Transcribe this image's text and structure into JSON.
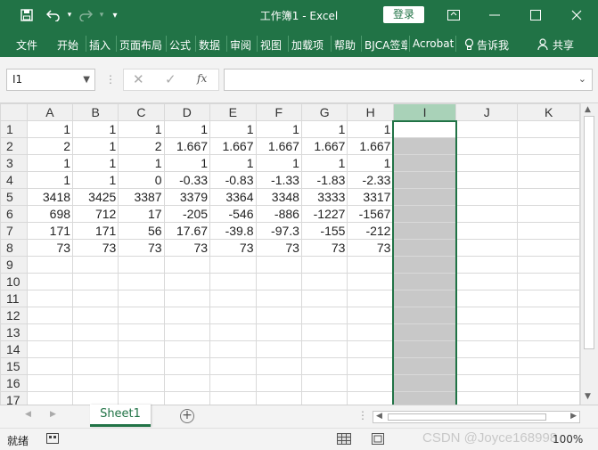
{
  "title": {
    "window_title": "工作簿1  -  Excel",
    "login_label": "登录"
  },
  "ribbon": {
    "tabs": [
      "文件",
      "开始",
      "插入",
      "页面布局",
      "公式",
      "数据",
      "审阅",
      "视图",
      "加载项",
      "帮助",
      "BJCA签章",
      "Acrobat"
    ],
    "tell_me": "告诉我",
    "share": "共享"
  },
  "formula_bar": {
    "name_box": "I1",
    "fx_label": "fx",
    "formula": ""
  },
  "grid": {
    "columns": [
      "A",
      "B",
      "C",
      "D",
      "E",
      "F",
      "G",
      "H",
      "I",
      "J",
      "K"
    ],
    "selected_column": "I",
    "active_cell": "I1",
    "rows": [
      {
        "num": "1",
        "cells": [
          "1",
          "1",
          "1",
          "1",
          "1",
          "1",
          "1",
          "1",
          "",
          "",
          ""
        ]
      },
      {
        "num": "2",
        "cells": [
          "2",
          "1",
          "2",
          "1.667",
          "1.667",
          "1.667",
          "1.667",
          "1.667",
          "",
          "",
          ""
        ]
      },
      {
        "num": "3",
        "cells": [
          "1",
          "1",
          "1",
          "1",
          "1",
          "1",
          "1",
          "1",
          "",
          "",
          ""
        ]
      },
      {
        "num": "4",
        "cells": [
          "1",
          "1",
          "0",
          "-0.33",
          "-0.83",
          "-1.33",
          "-1.83",
          "-2.33",
          "",
          "",
          ""
        ]
      },
      {
        "num": "5",
        "cells": [
          "3418",
          "3425",
          "3387",
          "3379",
          "3364",
          "3348",
          "3333",
          "3317",
          "",
          "",
          ""
        ]
      },
      {
        "num": "6",
        "cells": [
          "698",
          "712",
          "17",
          "-205",
          "-546",
          "-886",
          "-1227",
          "-1567",
          "",
          "",
          ""
        ]
      },
      {
        "num": "7",
        "cells": [
          "171",
          "171",
          "56",
          "17.67",
          "-39.8",
          "-97.3",
          "-155",
          "-212",
          "",
          "",
          ""
        ]
      },
      {
        "num": "8",
        "cells": [
          "73",
          "73",
          "73",
          "73",
          "73",
          "73",
          "73",
          "73",
          "",
          "",
          ""
        ]
      },
      {
        "num": "9",
        "cells": [
          "",
          "",
          "",
          "",
          "",
          "",
          "",
          "",
          "",
          "",
          ""
        ]
      },
      {
        "num": "10",
        "cells": [
          "",
          "",
          "",
          "",
          "",
          "",
          "",
          "",
          "",
          "",
          ""
        ]
      },
      {
        "num": "11",
        "cells": [
          "",
          "",
          "",
          "",
          "",
          "",
          "",
          "",
          "",
          "",
          ""
        ]
      },
      {
        "num": "12",
        "cells": [
          "",
          "",
          "",
          "",
          "",
          "",
          "",
          "",
          "",
          "",
          ""
        ]
      },
      {
        "num": "13",
        "cells": [
          "",
          "",
          "",
          "",
          "",
          "",
          "",
          "",
          "",
          "",
          ""
        ]
      },
      {
        "num": "14",
        "cells": [
          "",
          "",
          "",
          "",
          "",
          "",
          "",
          "",
          "",
          "",
          ""
        ]
      },
      {
        "num": "15",
        "cells": [
          "",
          "",
          "",
          "",
          "",
          "",
          "",
          "",
          "",
          "",
          ""
        ]
      },
      {
        "num": "16",
        "cells": [
          "",
          "",
          "",
          "",
          "",
          "",
          "",
          "",
          "",
          "",
          ""
        ]
      },
      {
        "num": "17",
        "cells": [
          "",
          "",
          "",
          "",
          "",
          "",
          "",
          "",
          "",
          "",
          ""
        ]
      }
    ]
  },
  "sheets": {
    "tabs": [
      "Sheet1"
    ],
    "add_icon": "plus-circle-icon"
  },
  "status": {
    "text": "就绪",
    "zoom": "100%",
    "watermark": "CSDN @Joyce168998"
  },
  "colors": {
    "accent": "#217346",
    "selected_column_header": "#a9d2b8",
    "selected_cells": "#c8c8c8"
  }
}
